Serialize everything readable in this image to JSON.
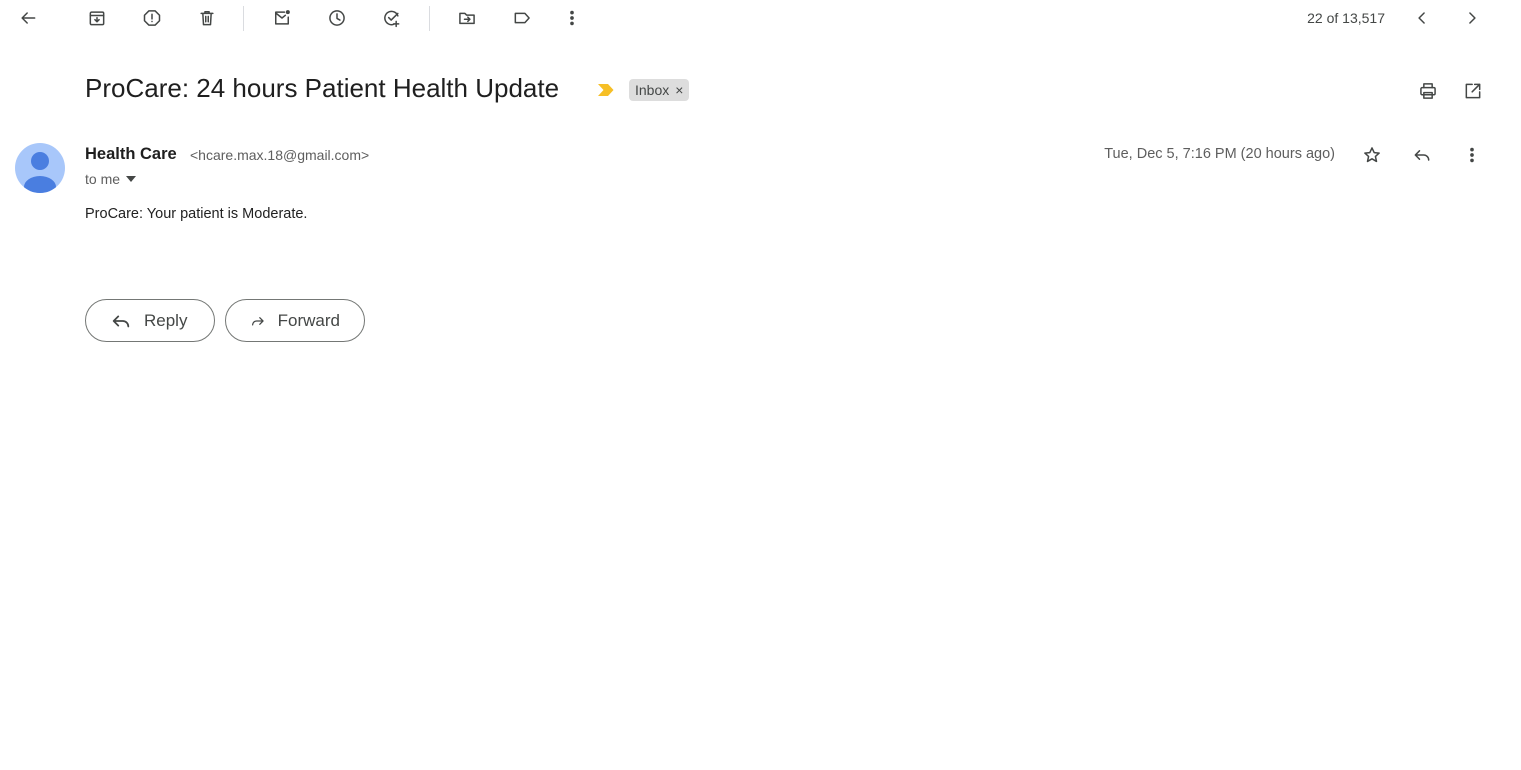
{
  "toolbar": {
    "counter": "22 of 13,517",
    "icons": [
      "back-arrow-icon",
      "archive-icon",
      "report-spam-icon",
      "delete-icon",
      "mark-unread-icon",
      "snooze-icon",
      "add-to-tasks-icon",
      "move-to-icon",
      "label-icon",
      "more-vert-icon",
      "chevron-left-icon",
      "chevron-right-icon"
    ]
  },
  "email": {
    "subject": "ProCare: 24 hours Patient Health Update",
    "label": "Inbox",
    "label_remove": "×",
    "sender_name": "Health Care",
    "sender_email": "<hcare.max.18@gmail.com>",
    "recipient": "to me",
    "date": "Tue, Dec 5, 7:16 PM (20 hours ago)",
    "body": "ProCare: Your patient is Moderate."
  },
  "actions": {
    "reply_label": "Reply",
    "forward_label": "Forward"
  },
  "colors": {
    "important_marker": "#f6bf26",
    "avatar_bg": "#a8c7fa",
    "avatar_fg": "#4a7ee0",
    "label_bg": "#dddddd"
  }
}
